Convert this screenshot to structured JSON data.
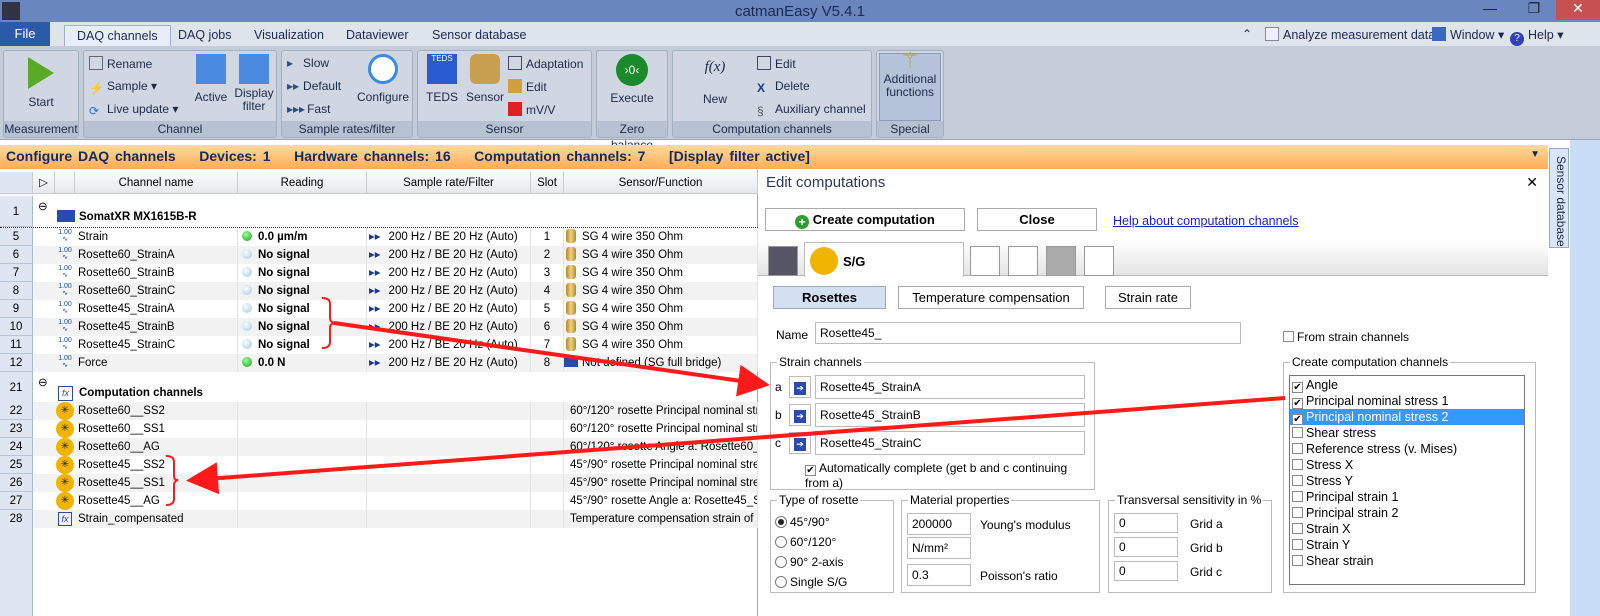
{
  "window": {
    "title": "catmanEasy V5.4.1",
    "minimize": "—",
    "restore": "❐",
    "close": "✕"
  },
  "menu": {
    "file": "File",
    "tabs": [
      "DAQ channels",
      "DAQ jobs",
      "Visualization",
      "Dataviewer",
      "Sensor database"
    ],
    "right": {
      "analyze": "Analyze measurement data",
      "window": "Window",
      "help": "Help"
    }
  },
  "ribbon": {
    "measurement": {
      "label": "Measurement",
      "start": "Start"
    },
    "channel": {
      "label": "Channel",
      "rename": "Rename",
      "sample": "Sample",
      "live_update": "Live update",
      "active": "Active",
      "display_filter": "Display filter"
    },
    "sample_rates": {
      "label": "Sample rates/filter",
      "slow": "Slow",
      "default": "Default",
      "fast": "Fast",
      "configure": "Configure"
    },
    "sensor": {
      "label": "Sensor",
      "teds": "TEDS",
      "sensor": "Sensor",
      "adaptation": "Adaptation",
      "edit": "Edit",
      "mvv": "mV/V"
    },
    "zero_balance": {
      "label": "Zero balance",
      "execute": "Execute"
    },
    "computation": {
      "label": "Computation channels",
      "new": "New",
      "edit": "Edit",
      "delete": "Delete",
      "auxiliary": "Auxiliary channel"
    },
    "special": {
      "label": "Special",
      "additional": "Additional functions"
    }
  },
  "status": {
    "title": "Configure DAQ channels",
    "devices": "Devices: 1",
    "hardware": "Hardware channels: 16",
    "computation": "Computation channels: 7",
    "filter": "[Display filter active]"
  },
  "grid": {
    "headers": [
      "Channel name",
      "Reading",
      "Sample rate/Filter",
      "Slot",
      "Sensor/Function"
    ],
    "device": {
      "num": "1",
      "name": "SomatXR MX1615B-R"
    },
    "hw_rows": [
      {
        "num": "5",
        "name": "Strain",
        "reading": "0.0 µm/m",
        "status": "green",
        "rate": "200 Hz / BE 20 Hz (Auto)",
        "slot": "1",
        "sensor": "SG 4 wire 350 Ohm"
      },
      {
        "num": "6",
        "name": "Rosette60_StrainA",
        "reading": "No signal",
        "status": "grey",
        "rate": "200 Hz / BE 20 Hz (Auto)",
        "slot": "2",
        "sensor": "SG 4 wire 350 Ohm"
      },
      {
        "num": "7",
        "name": "Rosette60_StrainB",
        "reading": "No signal",
        "status": "grey",
        "rate": "200 Hz / BE 20 Hz (Auto)",
        "slot": "3",
        "sensor": "SG 4 wire 350 Ohm"
      },
      {
        "num": "8",
        "name": "Rosette60_StrainC",
        "reading": "No signal",
        "status": "grey",
        "rate": "200 Hz / BE 20 Hz (Auto)",
        "slot": "4",
        "sensor": "SG 4 wire 350 Ohm"
      },
      {
        "num": "9",
        "name": "Rosette45_StrainA",
        "reading": "No signal",
        "status": "grey",
        "rate": "200 Hz / BE 20 Hz (Auto)",
        "slot": "5",
        "sensor": "SG 4 wire 350 Ohm"
      },
      {
        "num": "10",
        "name": "Rosette45_StrainB",
        "reading": "No signal",
        "status": "grey",
        "rate": "200 Hz / BE 20 Hz (Auto)",
        "slot": "6",
        "sensor": "SG 4 wire 350 Ohm"
      },
      {
        "num": "11",
        "name": "Rosette45_StrainC",
        "reading": "No signal",
        "status": "grey",
        "rate": "200 Hz / BE 20 Hz (Auto)",
        "slot": "7",
        "sensor": "SG 4 wire 350 Ohm"
      },
      {
        "num": "12",
        "name": "Force",
        "reading": "0.0 N",
        "status": "green",
        "rate": "200 Hz / BE 20 Hz (Auto)",
        "slot": "8",
        "sensor": "Not defined (SG full bridge)"
      }
    ],
    "comp_group": {
      "num": "21",
      "name": "Computation channels"
    },
    "comp_rows": [
      {
        "num": "22",
        "name": "Rosette60__SS2",
        "func": "60°/120° rosette Principal nominal stress",
        "icon": "rosette"
      },
      {
        "num": "23",
        "name": "Rosette60__SS1",
        "func": "60°/120° rosette Principal nominal stress",
        "icon": "rosette"
      },
      {
        "num": "24",
        "name": "Rosette60__AG",
        "func": "60°/120° rosette Angle a: Rosette60_St",
        "icon": "rosette"
      },
      {
        "num": "25",
        "name": "Rosette45__SS2",
        "func": "45°/90° rosette Principal nominal stress",
        "icon": "rosette"
      },
      {
        "num": "26",
        "name": "Rosette45__SS1",
        "func": "45°/90° rosette Principal nominal stress",
        "icon": "rosette"
      },
      {
        "num": "27",
        "name": "Rosette45__AG",
        "func": "45°/90° rosette Angle a: Rosette45_Stra",
        "icon": "rosette"
      },
      {
        "num": "28",
        "name": "Strain_compensated",
        "func": "Temperature compensation strain of Str",
        "icon": "fx"
      }
    ]
  },
  "panel": {
    "title": "Edit computations",
    "create": "Create computation",
    "close": "Close",
    "help_link": "Help about computation channels",
    "sg_tab": "S/G",
    "subtabs": [
      "Rosettes",
      "Temperature compensation",
      "Strain rate"
    ],
    "name_label": "Name",
    "name_value": "Rosette45_",
    "from_strain": "From strain channels",
    "strain_channels": {
      "label": "Strain channels",
      "rows": [
        {
          "key": "a",
          "value": "Rosette45_StrainA"
        },
        {
          "key": "b",
          "value": "Rosette45_StrainB"
        },
        {
          "key": "c",
          "value": "Rosette45_StrainC"
        }
      ],
      "auto_complete": "Automatically complete (get b and c continuing from a)",
      "auto_checked": true
    },
    "rosette_type": {
      "label": "Type of rosette",
      "options": [
        "45°/90°",
        "60°/120°",
        "90° 2-axis",
        "Single S/G"
      ],
      "selected": "45°/90°"
    },
    "material": {
      "label": "Material properties",
      "youngs_value": "200000",
      "youngs_label": "Young's modulus",
      "unit": "N/mm²",
      "poisson_value": "0.3",
      "poisson_label": "Poisson's ratio"
    },
    "transversal": {
      "label": "Transversal sensitivity in %",
      "rows": [
        {
          "value": "0",
          "label": "Grid a"
        },
        {
          "value": "0",
          "label": "Grid b"
        },
        {
          "value": "0",
          "label": "Grid c"
        }
      ]
    },
    "create_channels": {
      "label": "Create computation channels",
      "items": [
        {
          "label": "Angle",
          "checked": true
        },
        {
          "label": "Principal nominal stress 1",
          "checked": true
        },
        {
          "label": "Principal nominal stress 2",
          "checked": true,
          "selected": true
        },
        {
          "label": "Shear stress",
          "checked": false
        },
        {
          "label": "Reference stress (v. Mises)",
          "checked": false
        },
        {
          "label": "Stress X",
          "checked": false
        },
        {
          "label": "Stress Y",
          "checked": false
        },
        {
          "label": "Principal strain 1",
          "checked": false
        },
        {
          "label": "Principal strain 2",
          "checked": false
        },
        {
          "label": "Strain X",
          "checked": false
        },
        {
          "label": "Strain Y",
          "checked": false
        },
        {
          "label": "Shear strain",
          "checked": false
        }
      ]
    }
  },
  "sidebar_tab": "Sensor database",
  "colors": {
    "accent": "#2b5aa8",
    "status_bar": "#ffad55",
    "annotation": "#ff1a1a",
    "selection": "#3399ff",
    "rosette_icon": "#f0b400"
  }
}
